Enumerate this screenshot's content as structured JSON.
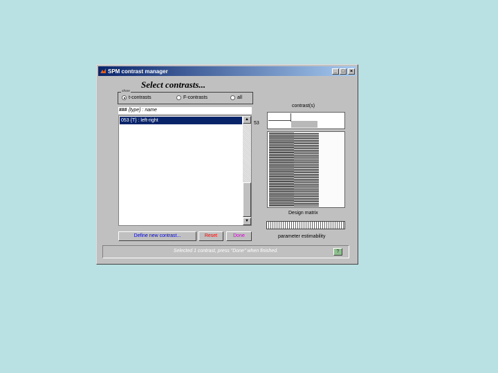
{
  "window": {
    "title": "SPM contrast manager"
  },
  "heading": "Select contrasts...",
  "show_group": {
    "legend": "show",
    "options": [
      {
        "label": "t-contrasts",
        "checked": true
      },
      {
        "label": "F-contrasts",
        "checked": false
      },
      {
        "label": "all",
        "checked": false
      }
    ]
  },
  "list": {
    "header_prefix": "###",
    "header_rest": " {type} : name",
    "items": [
      {
        "label": "053 {T} : left-right",
        "selected": true
      }
    ]
  },
  "buttons": {
    "define_new": "Define new contrast...",
    "reset": "Reset",
    "done": "Done"
  },
  "colors": {
    "reset_text": "#ff0000",
    "done_text": "#d000d0",
    "define_text": "#0000cc",
    "selection": "#0a246a"
  },
  "right_panel": {
    "contrast_label": "contrast(s)",
    "contrast_index": "53",
    "design_label": "Design matrix",
    "estimability_label": "parameter estimability"
  },
  "status": {
    "message": "Selected 1 contrast, press \"Done\" when finished.",
    "help_label": "?"
  }
}
